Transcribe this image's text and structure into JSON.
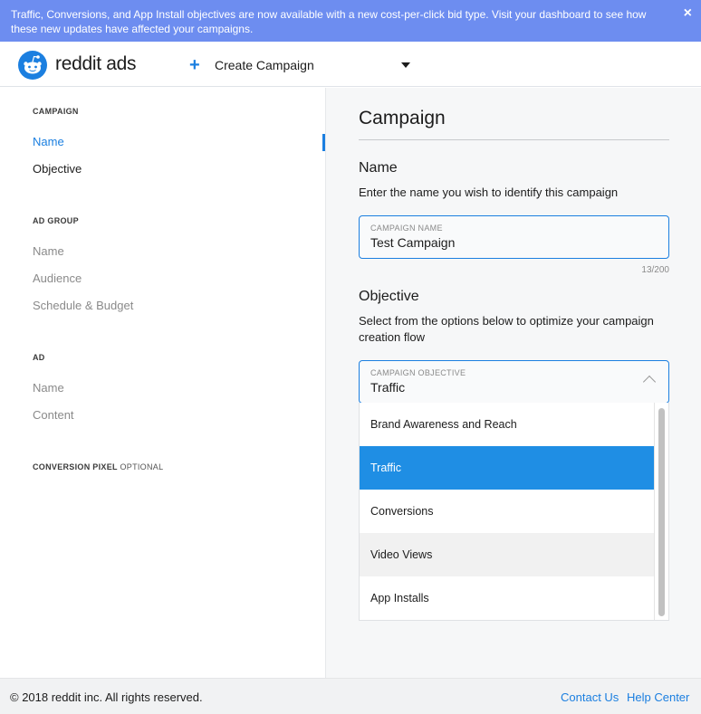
{
  "banner": {
    "text": "Traffic, Conversions, and App Install objectives are now available with a new cost-per-click bid type. Visit your dashboard to see how these new updates have affected your campaigns.",
    "close_glyph": "×"
  },
  "header": {
    "logo_text": "reddit ads",
    "create_label": "Create Campaign",
    "plus_glyph": "+"
  },
  "sidebar": {
    "campaign_heading": "CAMPAIGN",
    "campaign_items": [
      "Name",
      "Objective"
    ],
    "adgroup_heading": "AD GROUP",
    "adgroup_items": [
      "Name",
      "Audience",
      "Schedule & Budget"
    ],
    "ad_heading": "AD",
    "ad_items": [
      "Name",
      "Content"
    ],
    "pixel_heading": "CONVERSION PIXEL",
    "pixel_optional": "OPTIONAL"
  },
  "main": {
    "title": "Campaign",
    "name_section": {
      "title": "Name",
      "description": "Enter the name you wish to identify this campaign",
      "field_label": "CAMPAIGN NAME",
      "field_value": "Test Campaign",
      "counter": "13/200"
    },
    "objective_section": {
      "title": "Objective",
      "description": "Select from the options below to optimize your campaign creation flow",
      "field_label": "CAMPAIGN OBJECTIVE",
      "field_value": "Traffic",
      "options": [
        "Brand Awareness and Reach",
        "Traffic",
        "Conversions",
        "Video Views",
        "App Installs"
      ],
      "selected_option": "Traffic",
      "hovered_option": "Video Views"
    }
  },
  "footer": {
    "copyright": "© 2018 reddit inc. All rights reserved.",
    "contact_link": "Contact Us",
    "help_link": "Help Center"
  },
  "colors": {
    "banner_bg": "#6d8df0",
    "accent": "#1b7fe0",
    "selected_option_bg": "#1f8ee4",
    "logo_orange": "#1b7fe0"
  }
}
